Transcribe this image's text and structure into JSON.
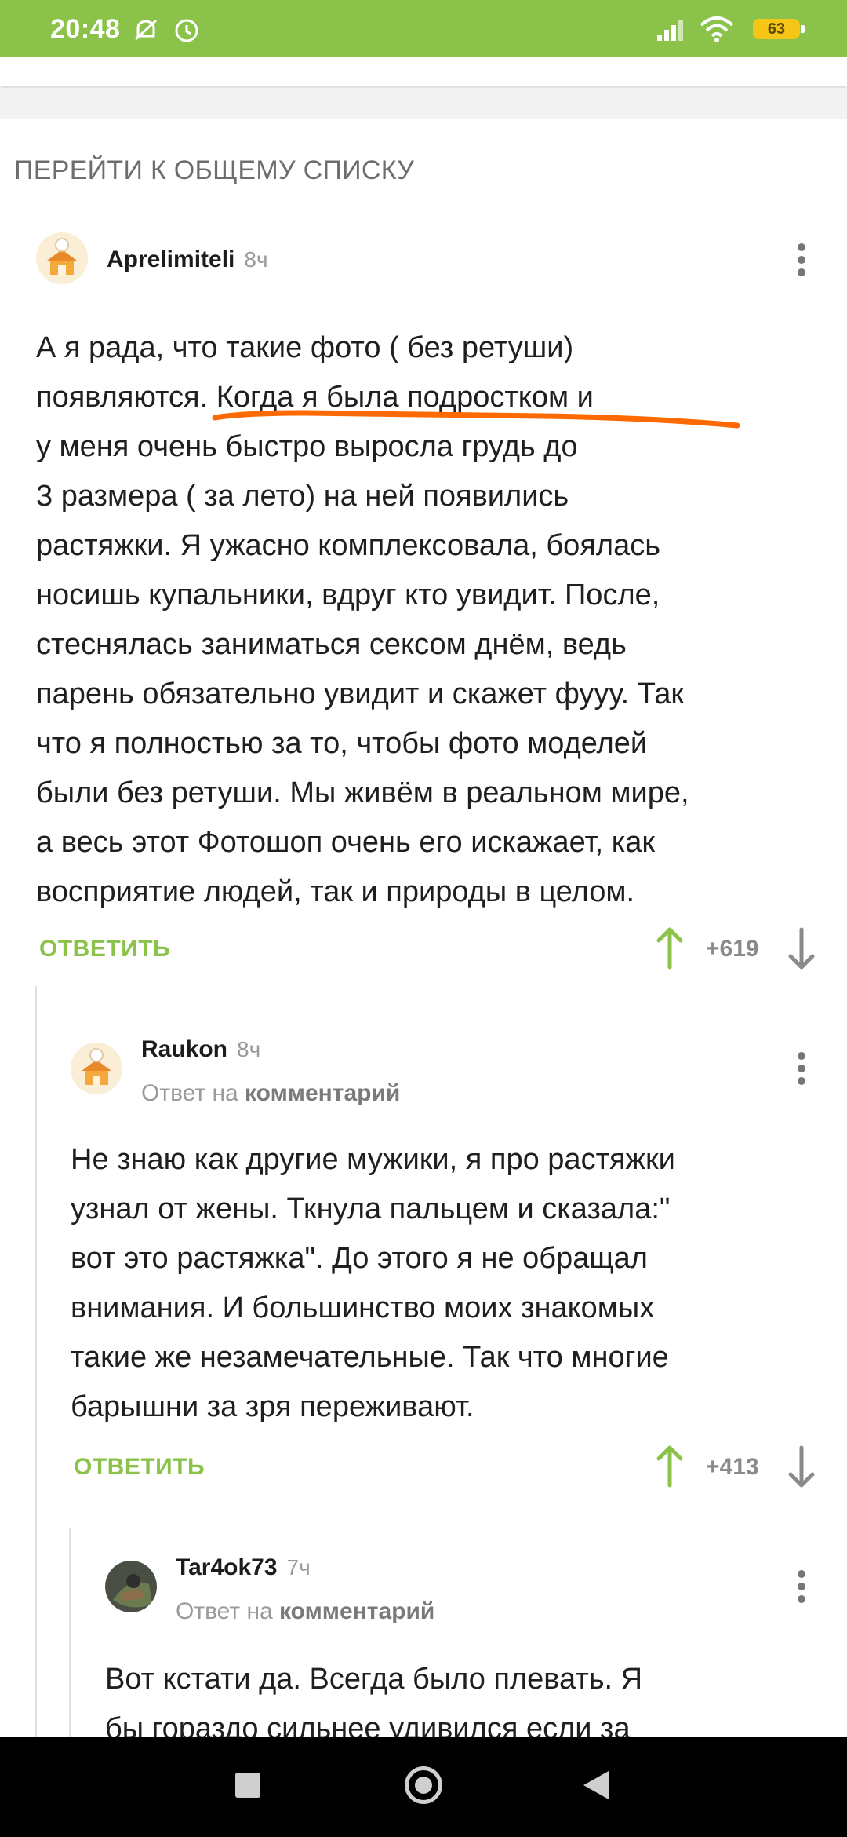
{
  "status_bar": {
    "time": "20:48",
    "battery": "63",
    "icons": [
      "mute-icon",
      "alarm-icon",
      "signal-icon",
      "wifi-icon",
      "battery-icon"
    ],
    "color": "#8bc34a"
  },
  "goto_list_label": "ПЕРЕЙТИ К ОБЩЕМУ СПИСКУ",
  "comments": [
    {
      "author": "Aprelimiteli",
      "time": "8ч",
      "lines": [
        "А я рада, что такие фото ( без ретуши)",
        "появляются. Когда я была подростком и",
        "у меня очень быстро выросла грудь до",
        "3 размера ( за лето) на ней появились",
        "растяжки. Я ужасно комплексовала, боялась",
        "носишь купальники, вдруг кто увидит. После,",
        "стеснялась заниматься сексом днём, ведь",
        "парень обязательно увидит и скажет фууу. Так",
        "что я полностью за то, чтобы фото моделей",
        "были без ретуши. Мы живём в реальном мире,",
        "а весь этот Фотошоп очень его искажает, как",
        "восприятие людей, так и природы в целом."
      ],
      "reply_label": "ОТВЕТИТЬ",
      "score": "+619"
    },
    {
      "author": "Raukon",
      "time": "8ч",
      "reply_prefix": "Ответ на",
      "reply_target": "комментарий",
      "lines": [
        "Не знаю как другие мужики, я про растяжки",
        "узнал от жены. Ткнула пальцем и сказала:\"",
        "вот это растяжка\". До этого я не обращал",
        "внимания. И большинство моих знакомых",
        "такие же незамечательные. Так что многие",
        "барышни за зря переживают."
      ],
      "reply_label": "ОТВЕТИТЬ",
      "score": "+413"
    },
    {
      "author": "Tar4ok73",
      "time": "7ч",
      "reply_prefix": "Ответ на",
      "reply_target": "комментарий",
      "lines": [
        "Вот кстати да. Всегда было плевать. Я",
        "бы гораздо сильнее удивился если за"
      ]
    }
  ],
  "highlight_color": "#ff6a00",
  "accent_color": "#8bc34a"
}
